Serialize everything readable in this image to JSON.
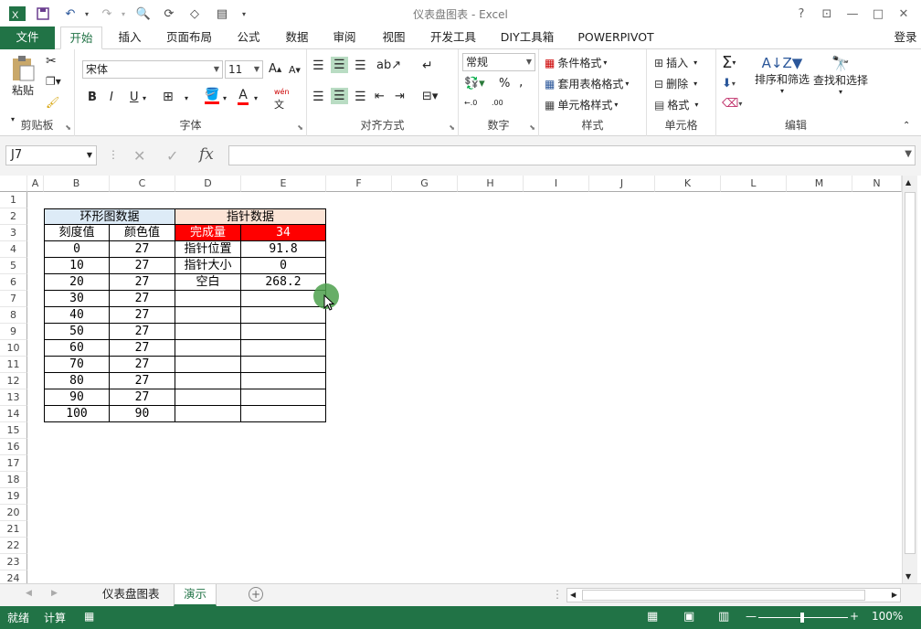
{
  "window": {
    "title": "仪表盘图表 - Excel",
    "help": "?",
    "login": "登录"
  },
  "tabs": [
    "文件",
    "开始",
    "插入",
    "页面布局",
    "公式",
    "数据",
    "审阅",
    "视图",
    "开发工具",
    "DIY工具箱",
    "POWERPIVOT"
  ],
  "ribbon": {
    "clipboard": {
      "paste": "粘贴",
      "label": "剪贴板"
    },
    "font": {
      "name": "宋体",
      "size": "11",
      "label": "字体",
      "bold": "B",
      "italic": "I",
      "underline": "U",
      "grow": "A",
      "shrink": "A",
      "color_a": "A",
      "phonetic": "wén"
    },
    "align": {
      "label": "对齐方式"
    },
    "number": {
      "format": "常规",
      "percent": "%",
      "comma": ",",
      "label": "数字",
      "inc": "←.0",
      "dec": ".00"
    },
    "styles": {
      "cond": "条件格式",
      "table": "套用表格格式",
      "cell": "单元格样式",
      "label": "样式"
    },
    "cells": {
      "insert": "插入",
      "delete": "删除",
      "format": "格式",
      "label": "单元格"
    },
    "editing": {
      "sort": "排序和筛选",
      "find": "查找和选择",
      "label": "编辑"
    }
  },
  "formula_bar": {
    "name_box": "J7",
    "fx": "fx",
    "value": ""
  },
  "columns": [
    "A",
    "B",
    "C",
    "D",
    "E",
    "F",
    "G",
    "H",
    "I",
    "J",
    "K",
    "L",
    "M",
    "N"
  ],
  "rows": [
    "1",
    "2",
    "3",
    "4",
    "5",
    "6",
    "7",
    "8",
    "9",
    "10",
    "11",
    "12",
    "13",
    "14",
    "15",
    "16",
    "17",
    "18",
    "19",
    "20",
    "21",
    "22",
    "23",
    "24"
  ],
  "table": {
    "ring_header": "环形图数据",
    "pointer_header": "指针数据",
    "col_scale": "刻度值",
    "col_color": "颜色值",
    "scale_values": [
      "0",
      "10",
      "20",
      "30",
      "40",
      "50",
      "60",
      "70",
      "80",
      "90",
      "100"
    ],
    "color_values": [
      "27",
      "27",
      "27",
      "27",
      "27",
      "27",
      "27",
      "27",
      "27",
      "27",
      "90"
    ],
    "pointer_labels": [
      "完成量",
      "指针位置",
      "指针大小",
      "空白"
    ],
    "pointer_values": [
      "34",
      "91.8",
      "0",
      "268.2"
    ]
  },
  "sheets": {
    "tab1": "仪表盘图表",
    "tab2": "演示"
  },
  "status": {
    "ready": "就绪",
    "calc": "计算",
    "zoom": "100%"
  },
  "colors": {
    "green": "#217346",
    "header_blue": "#ddebf7",
    "header_peach": "#fce4d6",
    "red": "#ff0000"
  }
}
